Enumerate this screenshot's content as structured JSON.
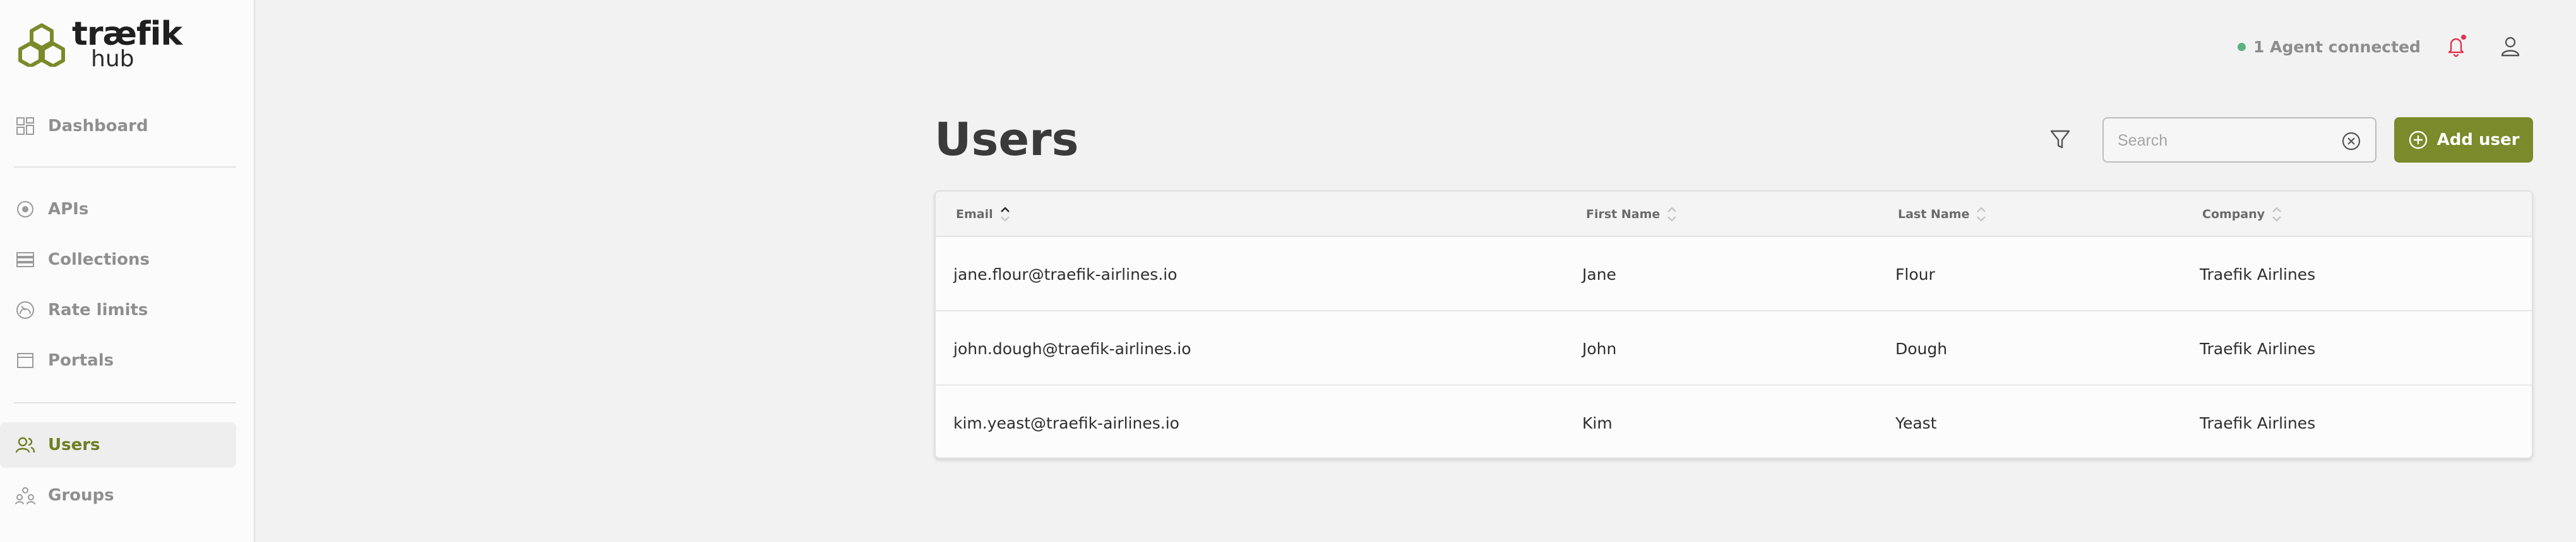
{
  "brand": {
    "name": "træfik",
    "sub": "hub",
    "color": "#6e7f22"
  },
  "sidebar": {
    "items": [
      {
        "label": "Dashboard",
        "icon": "dashboard-icon"
      },
      {
        "label": "APIs",
        "icon": "api-icon"
      },
      {
        "label": "Collections",
        "icon": "collections-icon"
      },
      {
        "label": "Rate limits",
        "icon": "rate-limit-icon"
      },
      {
        "label": "Portals",
        "icon": "portal-icon"
      },
      {
        "label": "Users",
        "icon": "users-icon",
        "active": true
      },
      {
        "label": "Groups",
        "icon": "groups-icon"
      }
    ]
  },
  "topbar": {
    "agent_status": "1 Agent connected",
    "status_color": "#5ab27e",
    "notification_color": "#e0334f"
  },
  "page": {
    "title": "Users",
    "search_placeholder": "Search",
    "add_button": "Add user",
    "accent": "#7b8a2a"
  },
  "table": {
    "columns": [
      "Email",
      "First Name",
      "Last Name",
      "Company"
    ],
    "sorted_column": "Email",
    "sort_direction": "ascending",
    "rows": [
      {
        "email": "jane.flour@traefik-airlines.io",
        "first_name": "Jane",
        "last_name": "Flour",
        "company": "Traefik Airlines"
      },
      {
        "email": "john.dough@traefik-airlines.io",
        "first_name": "John",
        "last_name": "Dough",
        "company": "Traefik Airlines"
      },
      {
        "email": "kim.yeast@traefik-airlines.io",
        "first_name": "Kim",
        "last_name": "Yeast",
        "company": "Traefik Airlines"
      }
    ]
  }
}
